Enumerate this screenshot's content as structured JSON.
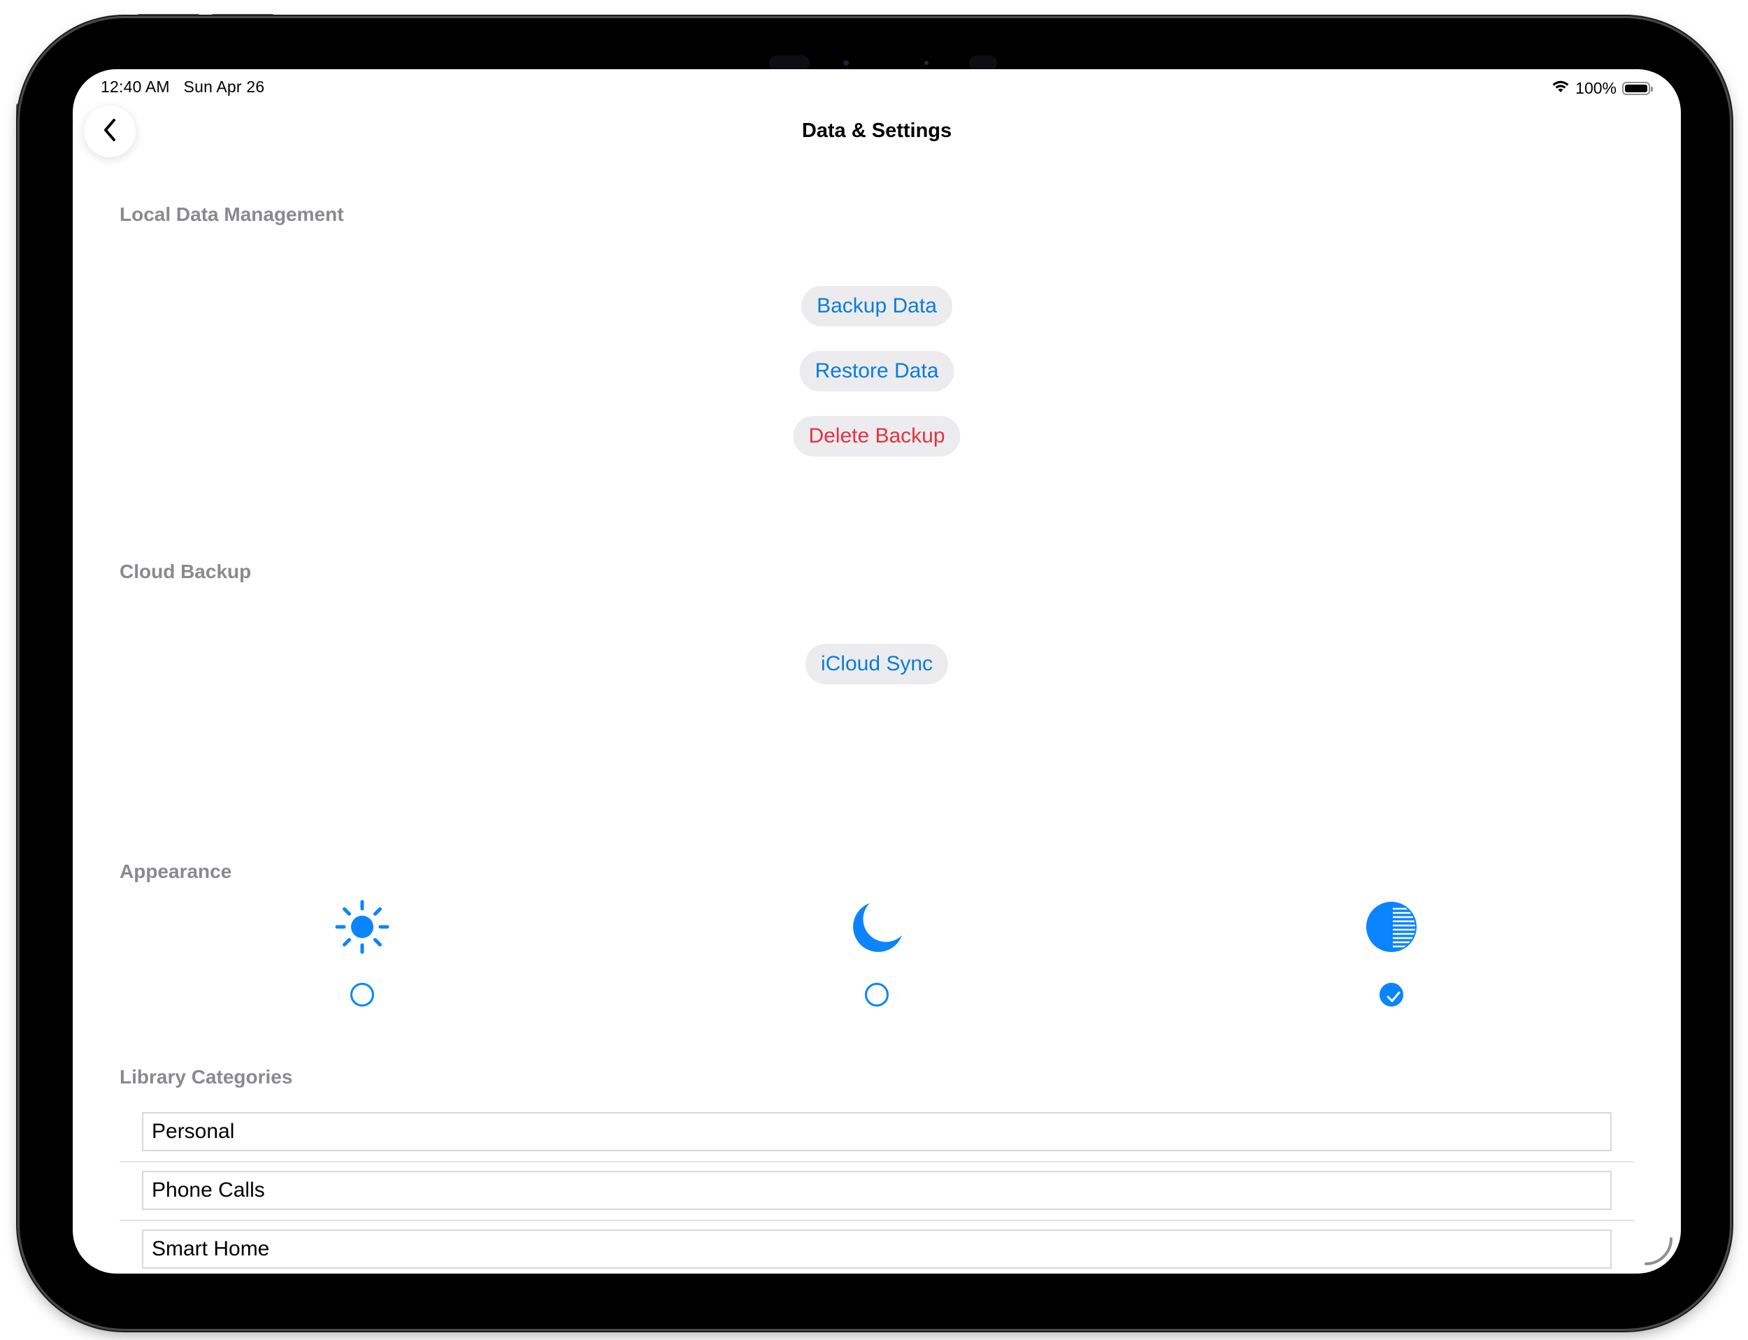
{
  "status_bar": {
    "time_date": "12:40 AM   Sun Apr 26",
    "battery_percent": "100%",
    "battery_level": 1.0,
    "wifi_icon": "wifi-icon",
    "battery_icon": "battery-icon"
  },
  "nav": {
    "title": "Data & Settings",
    "back_icon": "chevron-left-icon"
  },
  "sections": {
    "local": {
      "header": "Local Data Management",
      "backup_label": "Backup Data",
      "restore_label": "Restore Data",
      "delete_label": "Delete Backup"
    },
    "cloud": {
      "header": "Cloud Backup",
      "icloud_label": "iCloud Sync"
    },
    "appearance": {
      "header": "Appearance",
      "options": [
        {
          "icon": "sun-icon",
          "selected": false
        },
        {
          "icon": "moon-icon",
          "selected": false
        },
        {
          "icon": "circle-lefthalf-striped-icon",
          "selected": true
        }
      ]
    },
    "library": {
      "header": "Library Categories",
      "categories": [
        "Personal",
        "Phone Calls",
        "Smart Home"
      ]
    }
  },
  "colors": {
    "accent": "#0a84ff",
    "link_blue": "#0a7bdc",
    "destructive": "#e8303f",
    "section_header": "#8a8a8e"
  }
}
